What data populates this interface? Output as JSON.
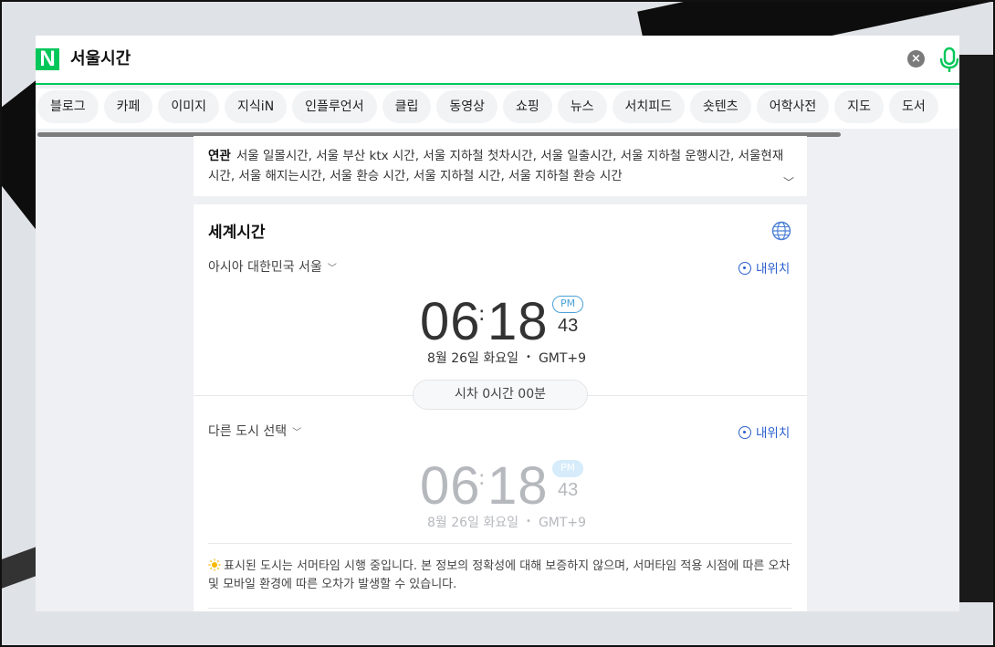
{
  "search": {
    "logo": "N",
    "query": "서울시간",
    "clear_glyph": "×"
  },
  "tabs": [
    "블로그",
    "카페",
    "이미지",
    "지식iN",
    "인플루언서",
    "클립",
    "동영상",
    "쇼핑",
    "뉴스",
    "서치피드",
    "숏텐츠",
    "어학사전",
    "지도",
    "도서"
  ],
  "related": {
    "title": "연관",
    "text": "서울 일몰시간, 서울 부산 ktx 시간, 서울 지하철 첫차시간, 서울 일출시간, 서울 지하철 운행시간, 서울현재시간, 서울 해지는시간, 서울 환승 시간, 서울 지하철 시간, 서울 지하철 환승 시간",
    "expand_glyph": "﹀"
  },
  "world_time": {
    "title": "세계시간",
    "locate_label": "내위치",
    "time_diff": "시차 0시간 00분",
    "primary": {
      "city": "아시아 대한민국 서울",
      "hour": "06",
      "minute": "18",
      "ampm": "PM",
      "second": "43",
      "date": "8월 26일 화요일",
      "tz": "GMT+9"
    },
    "secondary": {
      "city": "다른 도시 선택",
      "hour": "06",
      "minute": "18",
      "ampm": "PM",
      "second": "43",
      "date": "8월 26일 화요일",
      "tz": "GMT+9"
    },
    "notice": "표시된 도시는 서머타임 시행 중입니다. 본 정보의 정확성에 대해 보증하지 않으며, 서머타임 적용 시점에 따른 오차 및 모바일 환경에 따른 오차가 발생할 수 있습니다."
  },
  "colors": {
    "brand": "#03c75a",
    "link": "#2b5fcf",
    "ampm": "#4aa0d8"
  }
}
